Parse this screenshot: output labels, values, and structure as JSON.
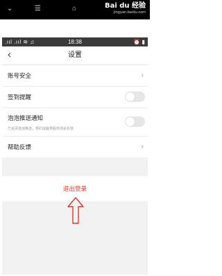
{
  "top_bar": {
    "nav_menu_glyph": "☰",
    "nav_home_glyph": "⌂",
    "nav_back_glyph": "⌄",
    "watermark_main": "Bai du 经验",
    "watermark_sub": "jingyan.baidu.com"
  },
  "status_bar": {
    "signal": ".ııl .ııl ≋ ♫",
    "time": "18:38",
    "icons": "⏰ ▮"
  },
  "header": {
    "back_glyph": "‹",
    "title": "设置"
  },
  "settings": {
    "account_security": "账号安全",
    "checkin_reminder": "签到提醒",
    "bubble_push": "泡泡推送通知",
    "bubble_push_note": "已关闭泡泡推送，预约提醒类服务则会失效",
    "help_feedback": "帮助反馈",
    "chevron": "›"
  },
  "toggles": {
    "checkin_reminder_on": false,
    "bubble_push_on": false
  },
  "logout": {
    "label": "退出登录"
  },
  "colors": {
    "logout_text": "#e0332a",
    "annotation_arrow": "#e0332a"
  },
  "icons": [
    "menu-icon",
    "home-icon",
    "back-icon",
    "chevron-right-icon",
    "toggle-switch",
    "up-arrow-annotation"
  ]
}
